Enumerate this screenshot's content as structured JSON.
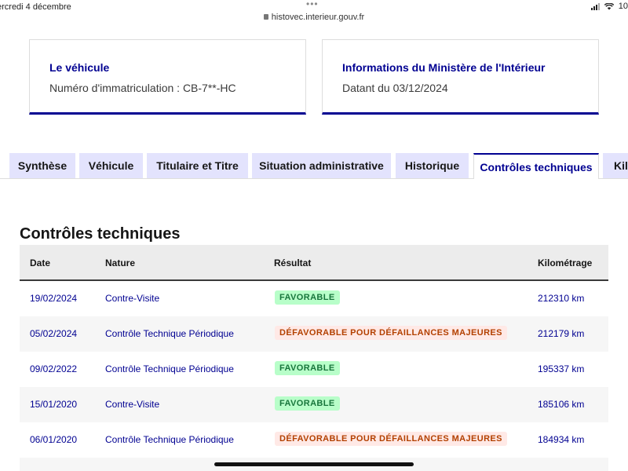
{
  "statusbar": {
    "date": "ercredi 4 décembre",
    "battery": "10"
  },
  "url": "histovec.interieur.gouv.fr",
  "cards": {
    "vehicle": {
      "title": "Le véhicule",
      "text": "Numéro d'immatriculation : CB-7**-HC"
    },
    "ministry": {
      "title": "Informations du Ministère de l'Intérieur",
      "text": "Datant du 03/12/2024"
    }
  },
  "tabs": [
    {
      "label": "Synthèse",
      "active": false
    },
    {
      "label": "Véhicule",
      "active": false
    },
    {
      "label": "Titulaire et Titre",
      "active": false
    },
    {
      "label": "Situation administrative",
      "active": false
    },
    {
      "label": "Historique",
      "active": false
    },
    {
      "label": "Contrôles techniques",
      "active": true
    },
    {
      "label": "Kil",
      "active": false
    }
  ],
  "section": {
    "title": "Contrôles techniques"
  },
  "table": {
    "headers": {
      "date": "Date",
      "nature": "Nature",
      "result": "Résultat",
      "km": "Kilométrage"
    },
    "rows": [
      {
        "date": "19/02/2024",
        "nature": "Contre-Visite",
        "result": "FAVORABLE",
        "result_type": "ok",
        "km": "212310 km"
      },
      {
        "date": "05/02/2024",
        "nature": "Contrôle Technique Périodique",
        "result": "DÉFAVORABLE POUR DÉFAILLANCES MAJEURES",
        "result_type": "ko",
        "km": "212179 km"
      },
      {
        "date": "09/02/2022",
        "nature": "Contrôle Technique Périodique",
        "result": "FAVORABLE",
        "result_type": "ok",
        "km": "195337 km"
      },
      {
        "date": "15/01/2020",
        "nature": "Contre-Visite",
        "result": "FAVORABLE",
        "result_type": "ok",
        "km": "185106 km"
      },
      {
        "date": "06/01/2020",
        "nature": "Contrôle Technique Périodique",
        "result": "DÉFAVORABLE POUR DÉFAILLANCES MAJEURES",
        "result_type": "ko",
        "km": "184934 km"
      }
    ]
  },
  "colors": {
    "primary": "#000091",
    "tab_bg": "#e3e3fd",
    "ok_bg": "#b8fec9",
    "ok_text": "#18753c",
    "ko_bg": "#ffe9e6",
    "ko_text": "#b34000"
  }
}
